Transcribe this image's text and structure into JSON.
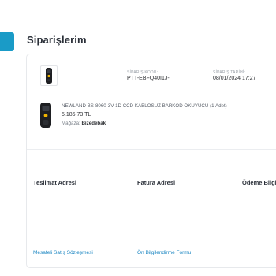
{
  "page": {
    "title": "Siparişlerim"
  },
  "order": {
    "code_label": "SİPARİŞ KODU:",
    "code_value": "PTT-EBFQ40I1J-",
    "date_label": "SİPARİŞ TARİHİ:",
    "date_value": "08/01/2024 17:27"
  },
  "product": {
    "name": "NEWLAND BS-8060-3V 1D CCD KABLOSUZ BARKOD OKUYUCU (1 Adet)",
    "price": "5.185,73 TL",
    "store_label": "Mağaza:",
    "store_name": "Bizedebak",
    "icon": "barcode-scanner-icon"
  },
  "sections": {
    "delivery_title": "Teslimat Adresi",
    "invoice_title": "Fatura Adresi",
    "payment_title": "Ödeme Bilgi"
  },
  "links": {
    "distance_sales": "Mesafeli Satış Sözleşmesi",
    "preliminary_info": "Ön Bilgilendirme Formu"
  },
  "colors": {
    "accent": "#1a9bc7",
    "link": "#1b86c2",
    "scanner_accent": "#f0b400"
  }
}
